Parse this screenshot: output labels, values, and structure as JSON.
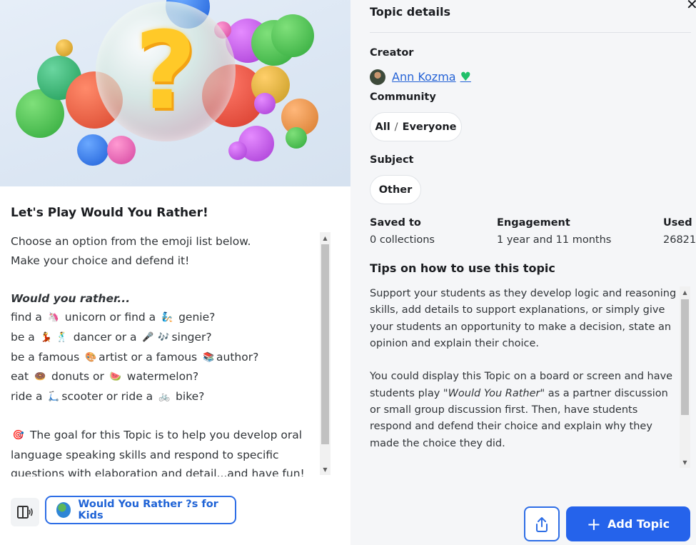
{
  "topic": {
    "title": "Let's Play Would You Rather!",
    "description": {
      "line1": "Choose an option from the emoji list below.",
      "line2": "Make your choice and defend it!",
      "prompt": "Would you rather...",
      "q1a": "find a",
      "q1b": "unicorn or find a",
      "q1c": "genie?",
      "q2a": "be a",
      "q2b": "dancer or a",
      "q2c": "singer?",
      "q3a": "be a famous",
      "q3b": "artist or a famous",
      "q3c": "author?",
      "q4a": "eat",
      "q4b": "donuts or",
      "q4c": "watermelon?",
      "q5a": "ride a",
      "q5b": "scooter or ride a",
      "q5c": "bike?",
      "goal1": "The goal for this Topic is to help you develop oral",
      "goal2": "language speaking skills and respond to specific",
      "goal3": "questions with elaboration and detail...and have fun!"
    },
    "emojis": [
      "unicorn-emoji",
      "genie-emoji",
      "dancer-emoji",
      "dancer-man-emoji",
      "microphone-emoji",
      "music-notes-emoji",
      "palette-emoji",
      "books-emoji",
      "donut-emoji",
      "watermelon-emoji",
      "scooter-emoji",
      "bike-emoji",
      "target-emoji"
    ],
    "group_button": "Would You Rather ?s for Kids"
  },
  "details": {
    "panel_title": "Topic details",
    "creator_label": "Creator",
    "creator_name": "Ann Kozma",
    "creator_heart": "♥",
    "community_label": "Community",
    "community_a": "All",
    "community_sep": "/",
    "community_b": "Everyone",
    "subject_label": "Subject",
    "subject_value": "Other",
    "saved_label": "Saved to",
    "saved_value": "0 collections",
    "engagement_label": "Engagement",
    "engagement_value": "1 year and 11 months",
    "used_label": "Used",
    "used_value": "26821",
    "tips_label": "Tips on how to use this topic",
    "tips_p1": "Support your students as they develop logic and reasoning skills, add details to support explanations, or simply give your students an opportunity to make a decision, state an opinion and explain their choice.",
    "tips_p2a": "You could display this Topic on a board or screen and have students play ",
    "tips_p2em": "\"Would You Rather\"",
    "tips_p2b": " as a partner discussion or small group discussion first. Then, have students respond and defend their choice and explain why they made the choice they did."
  },
  "actions": {
    "add_topic": "Add Topic",
    "close": "✕"
  },
  "colors": {
    "accent": "#2563eb",
    "link": "#2563d6",
    "heart": "#20c06a",
    "panel_bg": "#f5f6f8"
  }
}
